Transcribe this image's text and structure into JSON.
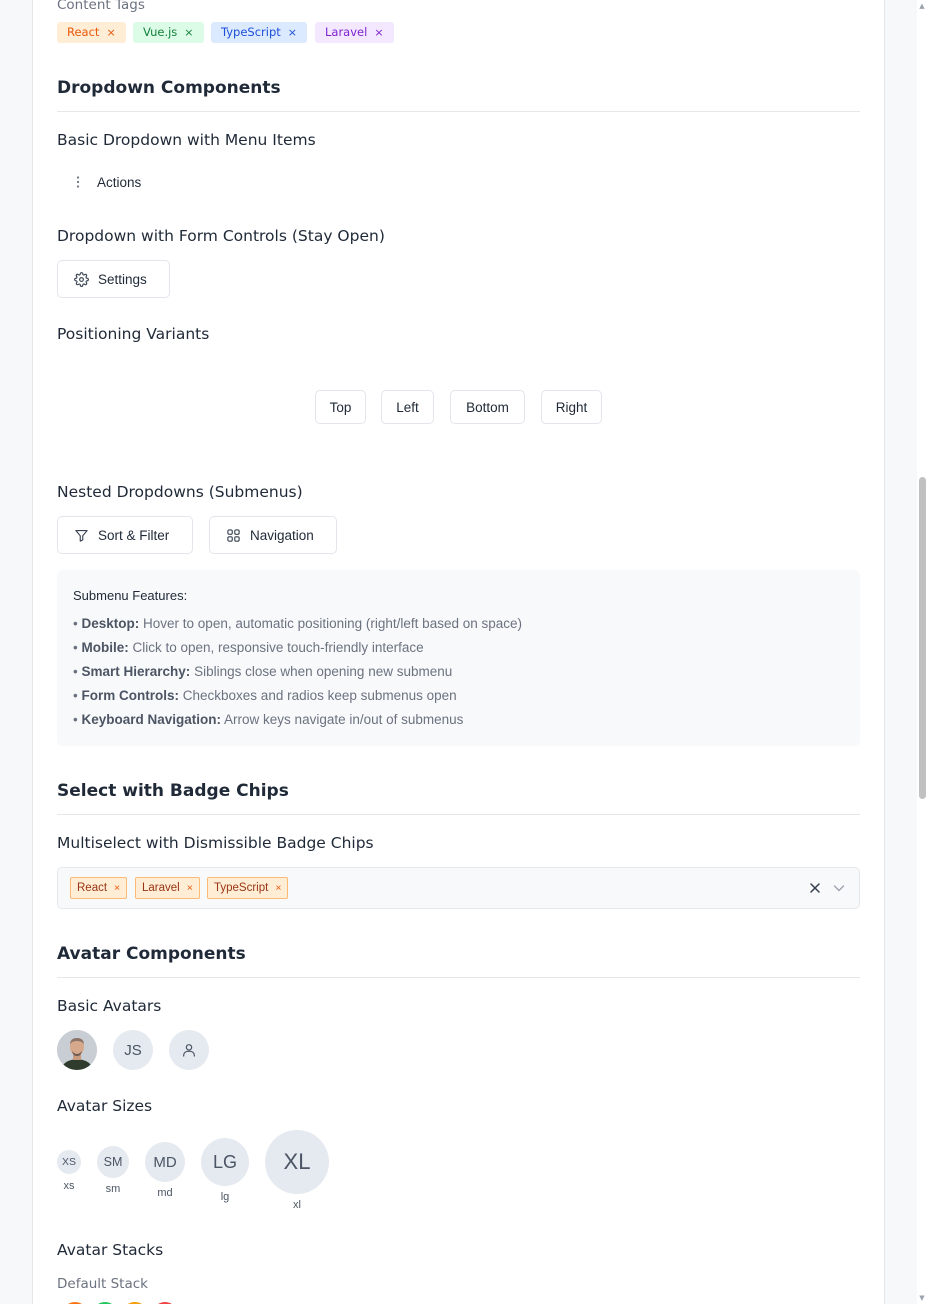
{
  "content_tags": {
    "label": "Content Tags",
    "tags": [
      {
        "label": "React",
        "remove": "×"
      },
      {
        "label": "Vue.js",
        "remove": "×"
      },
      {
        "label": "TypeScript",
        "remove": "×"
      },
      {
        "label": "Laravel",
        "remove": "×"
      }
    ]
  },
  "dropdown_section": {
    "title": "Dropdown Components",
    "basic": {
      "title": "Basic Dropdown with Menu Items",
      "icon": "more-vertical-icon",
      "trigger_label": "Actions"
    },
    "form_controls": {
      "title": "Dropdown with Form Controls (Stay Open)",
      "icon": "gear-icon",
      "button_label": "Settings"
    },
    "positioning": {
      "title": "Positioning Variants",
      "buttons": [
        "Top",
        "Left",
        "Bottom",
        "Right"
      ]
    },
    "nested": {
      "title": "Nested Dropdowns (Submenus)",
      "buttons": [
        {
          "label": "Sort & Filter",
          "icon": "filter-icon"
        },
        {
          "label": "Navigation",
          "icon": "grid-icon"
        }
      ],
      "features_title": "Submenu Features:",
      "features": [
        {
          "bullet": "•",
          "term": "Desktop:",
          "text": "Hover to open, automatic positioning (right/left based on space)"
        },
        {
          "bullet": "•",
          "term": "Mobile:",
          "text": "Click to open, responsive touch-friendly interface"
        },
        {
          "bullet": "•",
          "term": "Smart Hierarchy:",
          "text": "Siblings close when opening new submenu"
        },
        {
          "bullet": "•",
          "term": "Form Controls:",
          "text": "Checkboxes and radios keep submenus open"
        },
        {
          "bullet": "•",
          "term": "Keyboard Navigation:",
          "text": "Arrow keys navigate in/out of submenus"
        }
      ]
    }
  },
  "select_section": {
    "title": "Select with Badge Chips",
    "multiselect": {
      "title": "Multiselect with Dismissible Badge Chips",
      "chips": [
        {
          "label": "React",
          "remove": "×"
        },
        {
          "label": "Laravel",
          "remove": "×"
        },
        {
          "label": "TypeScript",
          "remove": "×"
        }
      ],
      "clear_icon": "close-icon",
      "toggle_icon": "chevron-down-icon"
    }
  },
  "avatar_section": {
    "title": "Avatar Components",
    "basic": {
      "title": "Basic Avatars",
      "initials": "JS",
      "placeholder_icon": "user-icon",
      "photo": "avatar-photo"
    },
    "sizes": {
      "title": "Avatar Sizes",
      "items": [
        {
          "initials": "XS",
          "label": "xs"
        },
        {
          "initials": "SM",
          "label": "sm"
        },
        {
          "initials": "MD",
          "label": "md"
        },
        {
          "initials": "LG",
          "label": "lg"
        },
        {
          "initials": "XL",
          "label": "xl"
        }
      ]
    },
    "stacks": {
      "title": "Avatar Stacks",
      "default_label": "Default Stack"
    }
  },
  "colors": {
    "stack_colors": [
      "#f97316",
      "#22c55e",
      "#f59e0b",
      "#ef4444"
    ]
  }
}
